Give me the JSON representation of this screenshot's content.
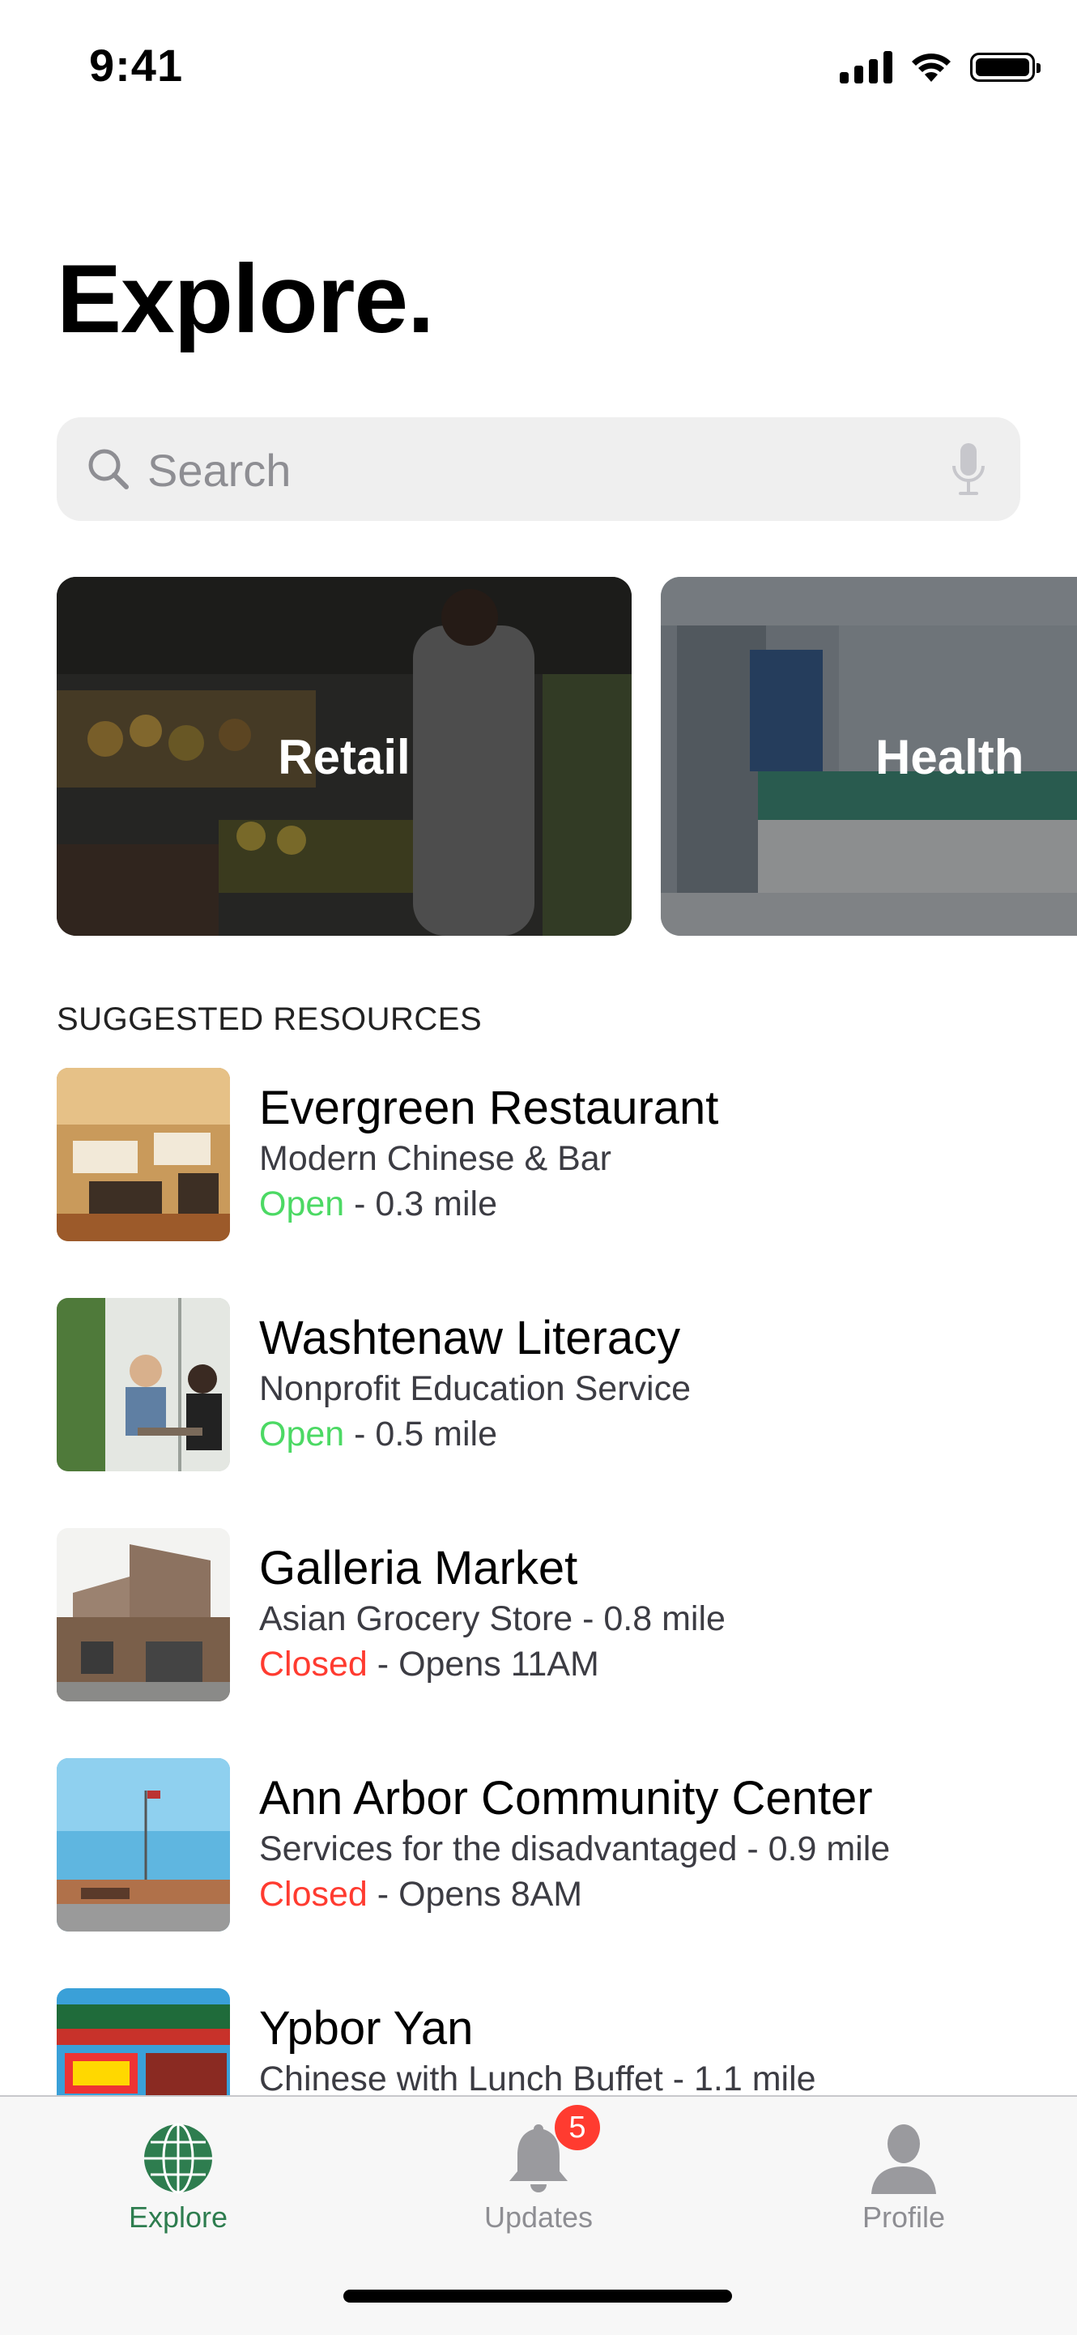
{
  "status_bar": {
    "time": "9:41"
  },
  "page": {
    "title": "Explore."
  },
  "search": {
    "placeholder": "Search"
  },
  "categories": [
    {
      "label": "Retail"
    },
    {
      "label": "Health"
    }
  ],
  "section": {
    "title": "SUGGESTED RESOURCES"
  },
  "resources": [
    {
      "name": "Evergreen Restaurant",
      "subtitle": "Modern Chinese & Bar",
      "status": "Open",
      "detail": " - 0.3 mile"
    },
    {
      "name": "Washtenaw Literacy",
      "subtitle": "Nonprofit Education Service",
      "status": "Open",
      "detail": " - 0.5 mile"
    },
    {
      "name": "Galleria Market",
      "subtitle": "Asian Grocery Store - 0.8 mile",
      "status": "Closed",
      "detail": " - Opens 11AM"
    },
    {
      "name": "Ann Arbor Community Center",
      "subtitle": "Services for the disadvantaged - 0.9 mile",
      "status": "Closed",
      "detail": " - Opens 8AM"
    },
    {
      "name": "Ypbor Yan",
      "subtitle": "Chinese with Lunch Buffet - 1.1 mile",
      "status": "",
      "detail": ""
    }
  ],
  "tab_bar": {
    "tabs": [
      {
        "label": "Explore",
        "icon": "globe-icon",
        "active": true
      },
      {
        "label": "Updates",
        "icon": "bell-icon",
        "badge": "5"
      },
      {
        "label": "Profile",
        "icon": "person-icon"
      }
    ]
  },
  "colors": {
    "accent": "#2e7d4f",
    "open": "#4cd964",
    "closed": "#ff3b30"
  }
}
